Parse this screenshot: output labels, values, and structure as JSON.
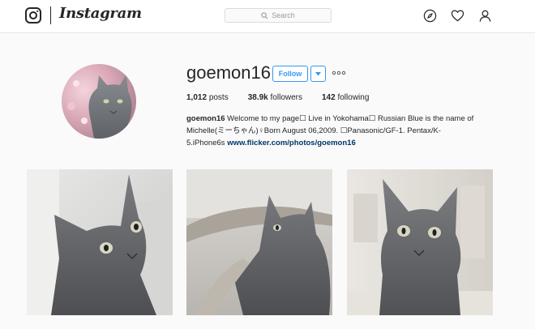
{
  "header": {
    "brand": "Instagram",
    "search_placeholder": "Search",
    "icons": [
      "instagram-camera-icon",
      "compass-icon",
      "heart-icon",
      "person-icon"
    ]
  },
  "profile": {
    "username": "goemon16",
    "follow_label": "Follow",
    "stats": {
      "posts_value": "1,012",
      "posts_label": "posts",
      "followers_value": "38.9k",
      "followers_label": "followers",
      "following_value": "142",
      "following_label": "following"
    },
    "bio": {
      "name": "goemon16",
      "line1": "Welcome to my page☐ Live in Yokohama☐ Russian Blue is the name of",
      "line2": "Michelle(ミーちゃん)♀Born August 06,2009. ☐Panasonic/GF-1. Pentax/K-",
      "line3": "5.iPhone6s",
      "link": "www.flicker.com/photos/goemon16"
    }
  },
  "posts": [
    {
      "alt": "gray cat looking up close"
    },
    {
      "alt": "gray cat sitting on chair"
    },
    {
      "alt": "gray cat sitting facing camera"
    }
  ],
  "colors": {
    "accent": "#3897f0",
    "link": "#003569",
    "background": "#fafafa"
  }
}
